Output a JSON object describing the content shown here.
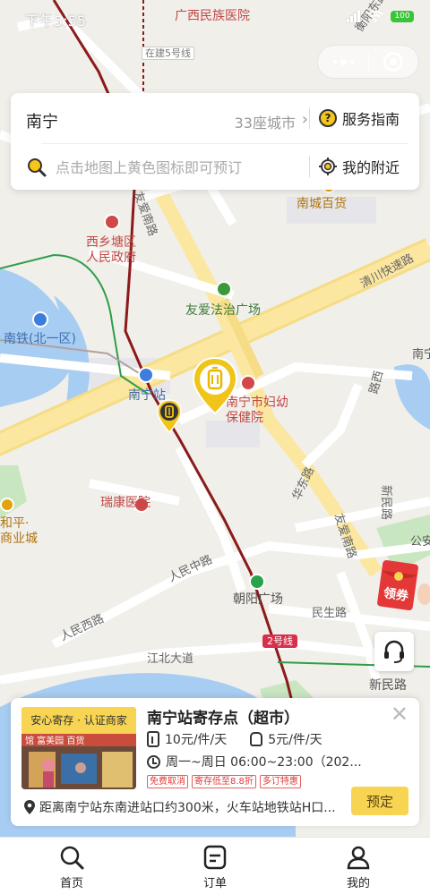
{
  "status_bar": {
    "time": "下午5:55",
    "battery": "100"
  },
  "map": {
    "poi": {
      "guangxi_hospital": "广西民族医院",
      "line5": "在建5号线",
      "hengyang_road": "衡阳东路",
      "nancheng": "南城百货",
      "xixiangtang": "西乡塘区\n人民政府",
      "youai_south_road": "友爱南路",
      "qingchuan_expressway": "清川快速路",
      "youai_plaza": "友爱法治广场",
      "nantie": "南铁(北一区)",
      "nanning_right": "南宁",
      "nanning_station": "南宁站",
      "maternal_hospital": "南宁市妇幼\n保健院",
      "ruikang_hospital": "瑞康医院",
      "heping_mall": "和平·\n商业城",
      "road_a": "路西",
      "road_b": "华东路",
      "xinmin_road_v": "新民路",
      "gongan": "公安",
      "youai_south_road2": "友爱南路",
      "renmin_mid_road": "人民中路",
      "chaoyang_plaza": "朝阳广场",
      "minsheng_road": "民生路",
      "renmin_west_road": "人民西路",
      "jiangbei_avenue": "江北大道",
      "line2": "2号线",
      "xinmin_road": "新民路"
    }
  },
  "search": {
    "city": "南宁",
    "city_count": "33座城市",
    "guide_label": "服务指南",
    "placeholder": "点击地图上黄色图标即可预订",
    "nearby_label": "我的附近"
  },
  "coupon": {
    "label": "领券"
  },
  "store": {
    "tag": "安心寄存 · 认证商家",
    "title": "南宁站寄存点（超市）",
    "price_bag": "10元/件/天",
    "price_backpack": "5元/件/天",
    "hours": "周一~周日 06:00~23:00（202...",
    "badges": [
      "免费取消",
      "寄存低至8.8折",
      "多订特惠"
    ],
    "address": "距离南宁站东南进站口约300米，火车站地铁站H口...",
    "book_label": "预定",
    "photo_sign": "馆 富美园 百货"
  },
  "tabs": [
    {
      "label": "首页",
      "icon": "search-icon"
    },
    {
      "label": "订单",
      "icon": "order-icon"
    },
    {
      "label": "我的",
      "icon": "user-icon"
    }
  ],
  "colors": {
    "accent": "#f7d451",
    "marker": "#e8b800",
    "metro_line": "#8b1a1a",
    "green_line": "#2e9e4a"
  }
}
